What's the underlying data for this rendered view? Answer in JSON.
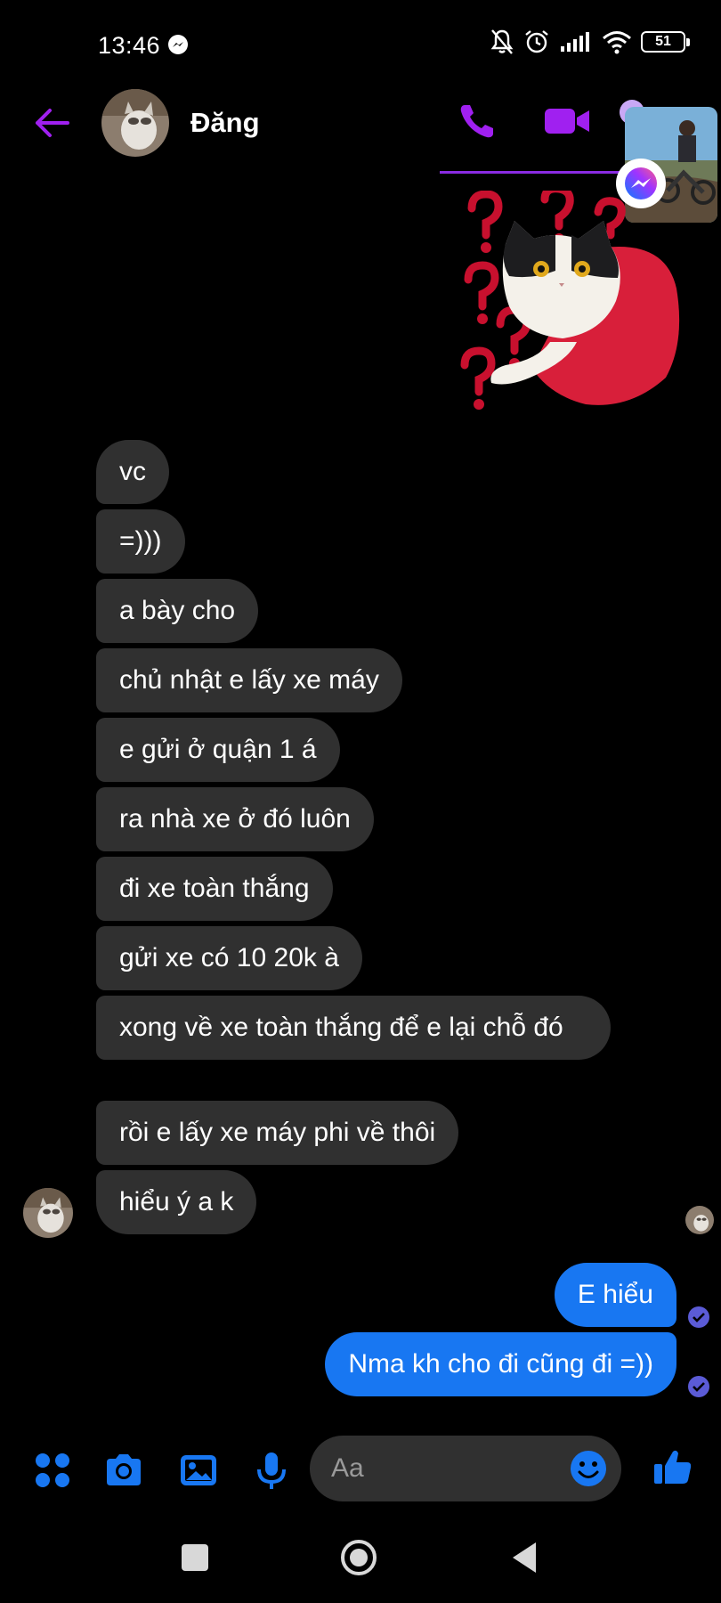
{
  "status_bar": {
    "time": "13:46",
    "battery": "51"
  },
  "header": {
    "contact_name": "Đăng"
  },
  "messages_in": [
    {
      "text": "vc"
    },
    {
      "text": "=)))"
    },
    {
      "text": "a bày cho"
    },
    {
      "text": "chủ nhật e lấy xe máy"
    },
    {
      "text": "e gửi ở quận 1 á"
    },
    {
      "text": "ra nhà xe ở đó luôn"
    },
    {
      "text": "đi xe toàn thắng"
    },
    {
      "text": "gửi xe có 10 20k à"
    },
    {
      "text": "xong về xe toàn thắng để e lại chỗ đó"
    },
    {
      "text": "rồi e lấy xe máy phi về thôi"
    },
    {
      "text": "hiểu ý a k"
    }
  ],
  "messages_out": [
    {
      "text": "E hiểu"
    },
    {
      "text": "Nma kh cho đi cũng đi =))"
    }
  ],
  "composer": {
    "placeholder": "Aa"
  },
  "colors": {
    "accent_purple": "#a020f0",
    "outgoing_bubble": "#1877f2",
    "incoming_bubble": "#303030",
    "background": "#000000"
  },
  "icons": [
    "arrow-left-icon",
    "phone-icon",
    "video-camera-icon",
    "apps-icon",
    "camera-icon",
    "image-icon",
    "microphone-icon",
    "emoji-icon",
    "thumbs-up-icon",
    "messenger-icon"
  ]
}
